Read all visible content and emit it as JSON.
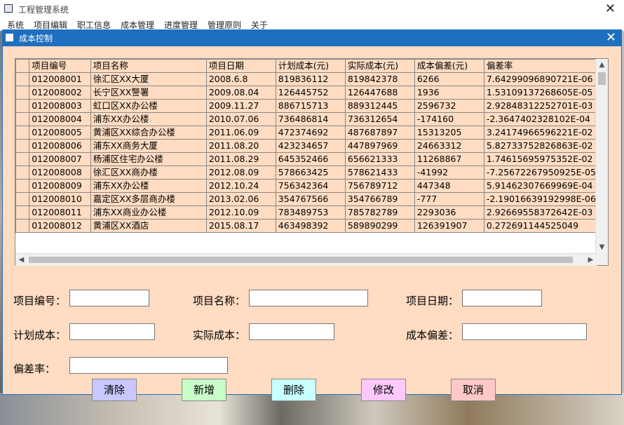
{
  "main_window": {
    "title": "工程管理系统",
    "close_glyph": "✕",
    "menu": [
      "系统",
      "项目编辑",
      "职工信息",
      "成本管理",
      "进度管理",
      "管理原则",
      "关于"
    ]
  },
  "dialog": {
    "title": "成本控制",
    "close_glyph": "✕"
  },
  "grid": {
    "columns": [
      "项目编号",
      "项目名称",
      "项目日期",
      "计划成本(元)",
      "实际成本(元)",
      "成本偏差(元)",
      "偏差率"
    ],
    "rows": [
      [
        "012008001",
        "徐汇区XX大厦",
        "2008.6.8",
        "819836112",
        "819842378",
        "6266",
        "7.64299096890721E-06"
      ],
      [
        "012008002",
        "长宁区XX警署",
        "2009.08.04",
        "126445752",
        "126447688",
        "1936",
        "1.53109137268605E-05"
      ],
      [
        "012008003",
        "虹口区XX办公楼",
        "2009.11.27",
        "886715713",
        "889312445",
        "2596732",
        "2.92848312252701E-03"
      ],
      [
        "012008004",
        "浦东XX办公楼",
        "2010.07.06",
        "736486814",
        "736312654",
        "-174160",
        "-2.3647402328102E-04"
      ],
      [
        "012008005",
        "黄浦区XX综合办公楼",
        "2011.06.09",
        "472374692",
        "487687897",
        "15313205",
        "3.24174966596221E-02"
      ],
      [
        "012008006",
        "浦东XX商务大厦",
        "2011.08.20",
        "423234657",
        "447897969",
        "24663312",
        "5.82733752826863E-02"
      ],
      [
        "012008007",
        "杨浦区住宅办公楼",
        "2011.08.29",
        "645352466",
        "656621333",
        "11268867",
        "1.74615695975352E-02"
      ],
      [
        "012008008",
        "徐汇区XX商办楼",
        "2012.08.09",
        "578663425",
        "578621433",
        "-41992",
        "-7.25672267950925E-05"
      ],
      [
        "012008009",
        "浦东XX办公楼",
        "2012.10.24",
        "756342364",
        "756789712",
        "447348",
        "5.91462307669969E-04"
      ],
      [
        "012008010",
        "嘉定区XX多层商办楼",
        "2013.02.06",
        "354767566",
        "354766789",
        "-777",
        "-2.19016639192998E-06"
      ],
      [
        "012008011",
        "浦东XX商业办公楼",
        "2012.10.09",
        "783489753",
        "785782789",
        "2293036",
        "2.92669558372642E-03"
      ],
      [
        "012008012",
        "黄浦区XX酒店",
        "2015.08.17",
        "463498392",
        "589890299",
        "126391907",
        "0.272691144525049"
      ]
    ]
  },
  "form": {
    "project_id_label": "项目编号：",
    "project_name_label": "项目名称：",
    "project_date_label": "项目日期：",
    "planned_cost_label": "计划成本：",
    "actual_cost_label": "实际成本：",
    "cost_variance_label": "成本偏差：",
    "variance_rate_label": "偏差率：",
    "project_id_value": "",
    "project_name_value": "",
    "project_date_value": "",
    "planned_cost_value": "",
    "actual_cost_value": "",
    "cost_variance_value": "",
    "variance_rate_value": ""
  },
  "buttons": {
    "clear": "清除",
    "add": "新增",
    "delete": "删除",
    "modify": "修改",
    "cancel": "取消"
  },
  "colors": {
    "dialog_bg": "#ffdcc2",
    "titlebar": "#1e6fbf",
    "btn_clear": "#c8c8ff",
    "btn_add": "#c8ffc8",
    "btn_delete": "#c8ffff",
    "btn_modify": "#ffc8ff",
    "btn_cancel": "#ffc8c8"
  }
}
